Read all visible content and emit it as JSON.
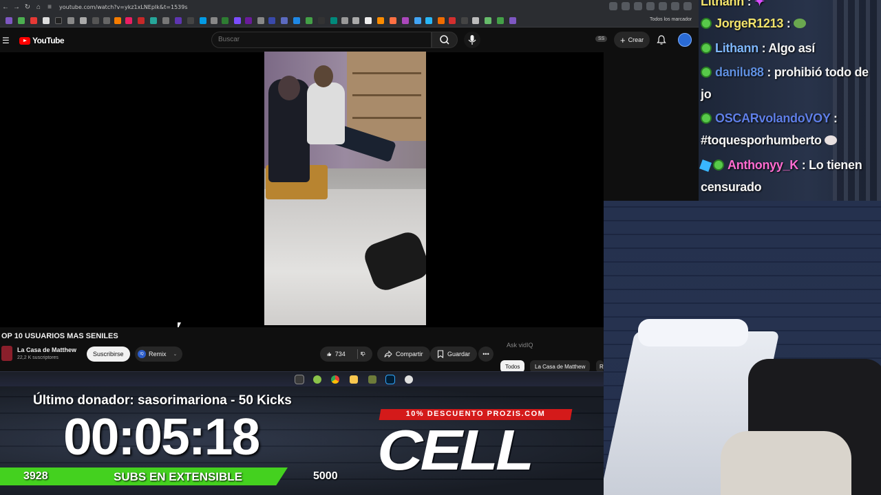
{
  "browser": {
    "url": "youtube.com/watch?v=ykz1xLNEpIk&t=1539s",
    "all_bookmarks": "Todos los marcador"
  },
  "youtube": {
    "logo": "YouTube",
    "search_placeholder": "Buscar",
    "ss_badge": "SS",
    "create_label": "Crear"
  },
  "video": {
    "title": "OP 10 USUARIOS MAS SENILES",
    "channel": "La Casa de Matthew",
    "subscribers": "22,2 K suscriptores",
    "subscribe_label": "Suscribirse",
    "remix_label": "Remix",
    "likes": "734",
    "share_label": "Compartir",
    "save_label": "Guardar",
    "ask_placeholder": "Ask vidIQ",
    "chips": [
      "Todos",
      "La Casa de Matthew",
      "R"
    ]
  },
  "chat": {
    "messages": [
      {
        "user": "Lithann",
        "text": ":"
      },
      {
        "user": "JorgeR1213",
        "text": ":"
      },
      {
        "user": "Lithann",
        "text": ": Algo así"
      },
      {
        "user": "danilu88",
        "text": ": prohibió todo de jo"
      },
      {
        "user": "OSCARvolandoVOY",
        "text": ": #toquesporhumberto"
      },
      {
        "user": "Anthonyy_K",
        "text": ": Lo tienen censurado"
      }
    ]
  },
  "overlay": {
    "donor": "Último donador: sasorimariona - 50 Kicks",
    "timer": "00:05:18",
    "subs_current": "3928",
    "subs_label": "SUBS EN EXTENSIBLE",
    "subs_target": "5000",
    "promo": "10% DESCUENTO PROZIS.COM",
    "brand": "CELL"
  },
  "colors": {
    "subs_bar": "#44d11f",
    "promo_red": "#d41a1a",
    "yt_red": "#ff0000"
  }
}
